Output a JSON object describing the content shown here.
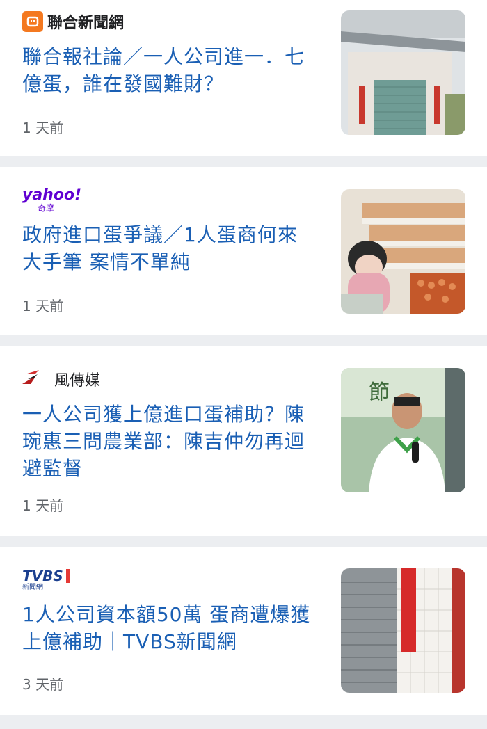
{
  "articles": [
    {
      "source": "聯合新聞網",
      "title": "聯合報社論／一人公司進一．七億蛋，誰在發國難財？",
      "time": "1 天前",
      "image": "closed-shop-storefront"
    },
    {
      "source": "yahoo!",
      "source_sub": "奇摩",
      "title": "政府進口蛋爭議／1人蛋商何來大手筆 案情不單純",
      "time": "1 天前",
      "image": "supermarket-egg-shelf"
    },
    {
      "source": "風傳媒",
      "title": "一人公司獲上億進口蛋補助？陳琬惠三問農業部：陳吉仲勿再迴避監督",
      "time": "1 天前",
      "image": "man-speaking-microphone"
    },
    {
      "source": "TVBS",
      "source_sub": "新聞網",
      "title": "1人公司資本額50萬 蛋商遭爆獲上億補助｜TVBS新聞網",
      "time": "3 天前",
      "image": "shuttered-door-couplet"
    }
  ],
  "colors": {
    "headline": "#1a5fb4",
    "udn_logo": "#f47920",
    "yahoo": "#6001d2",
    "storm": "#d32f2f",
    "tvbs": "#1b3f8f"
  }
}
